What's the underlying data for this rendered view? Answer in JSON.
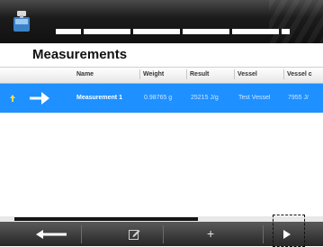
{
  "header": {
    "app_icon": "balance-icon",
    "segments": 6
  },
  "page": {
    "title": "Measurements"
  },
  "table": {
    "columns": [
      "Name",
      "Weight",
      "Result",
      "Vessel",
      "Vessel c"
    ],
    "rows": [
      {
        "name": "Measurement 1",
        "weight": "0.98765 g",
        "result": "25215 J/g",
        "vessel": "Test Vessel",
        "vessel_c": "7955 J/"
      }
    ]
  },
  "toolbar": {
    "back_icon": "back-arrow-icon",
    "edit_icon": "edit-icon",
    "add_label": "+",
    "play_icon": "play-icon"
  },
  "colors": {
    "selection": "#1e90ff",
    "header_bg": "#111111",
    "toolbar_bg": "#2f2f2f"
  }
}
